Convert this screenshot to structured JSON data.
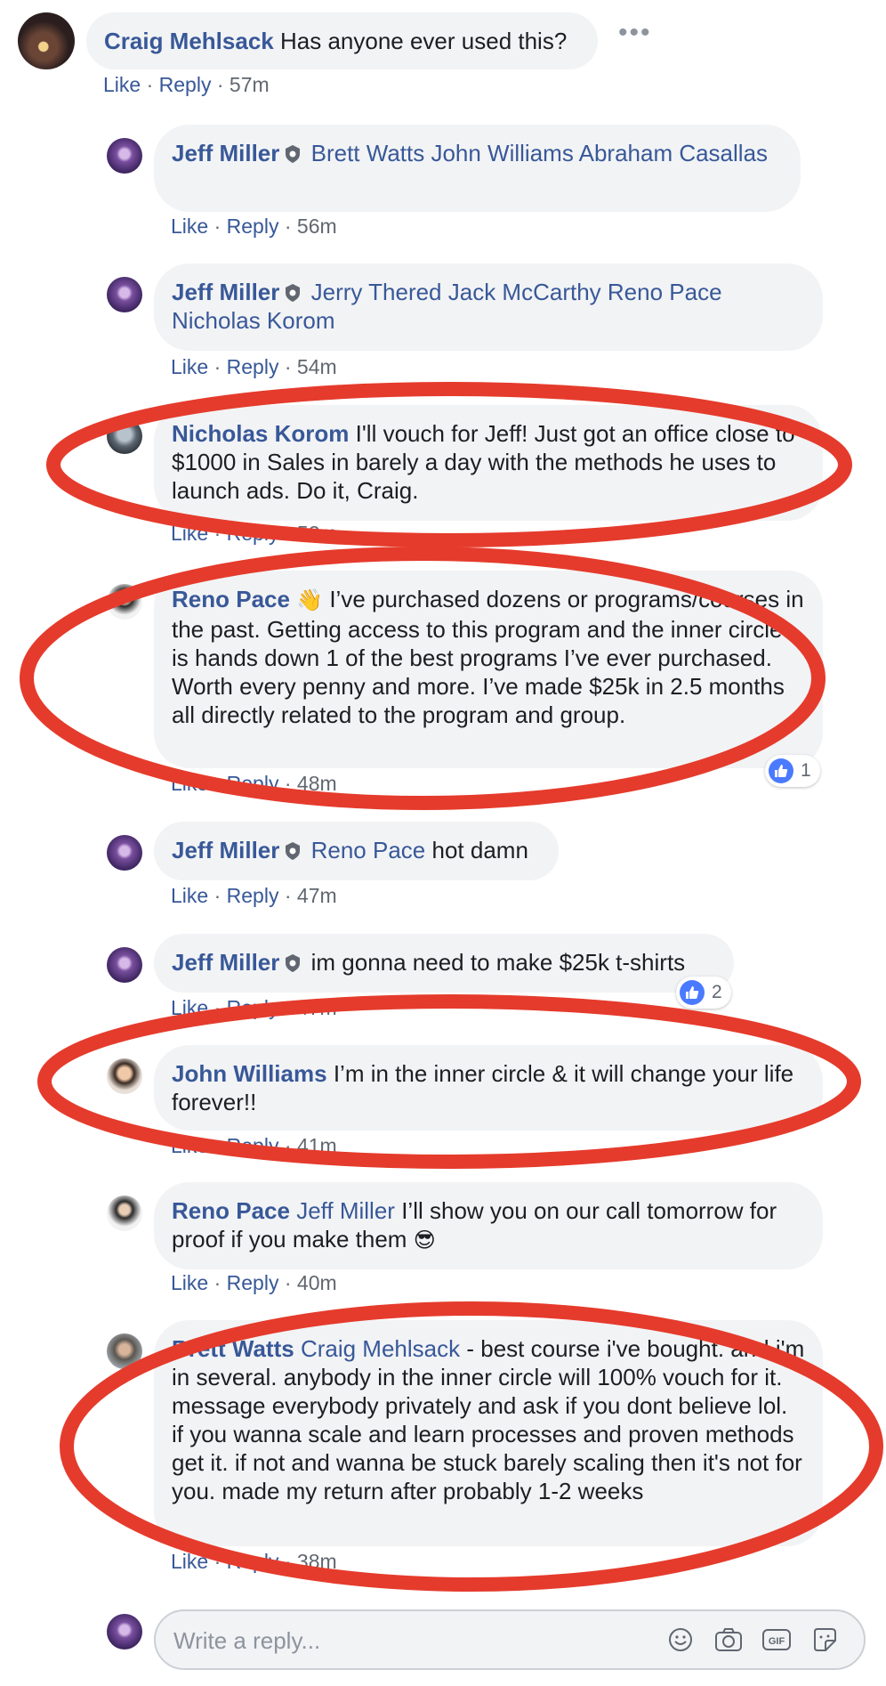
{
  "comments": {
    "top": {
      "author": "Craig Mehlsack",
      "text": "Has anyone ever used this?",
      "like": "Like",
      "reply": "Reply",
      "time": "57m"
    },
    "r1": {
      "author": "Jeff Miller",
      "tags": "Brett Watts John Williams Abraham Casallas",
      "text": "",
      "like": "Like",
      "reply": "Reply",
      "time": "56m"
    },
    "r2": {
      "author": "Jeff Miller",
      "tags": "Jerry Thered Jack McCarthy Reno Pace Nicholas Korom",
      "text": "",
      "like": "Like",
      "reply": "Reply",
      "time": "54m"
    },
    "r3": {
      "author": "Nicholas Korom",
      "text": "I'll vouch for Jeff! Just got an office close to $1000 in Sales in barely a day with the methods he uses to launch ads. Do it, Craig.",
      "like": "Like",
      "reply": "Reply",
      "time": "52m"
    },
    "r4": {
      "author": "Reno Pace",
      "emoji": "👋",
      "text": "I’ve purchased dozens or programs/courses in the past. Getting access to this program and the inner circle is hands down 1 of the best programs I’ve ever purchased. Worth every penny and more. I’ve made $25k in 2.5 months all directly related to the program and group.",
      "like": "Like",
      "reply": "Reply",
      "time": "48m",
      "reactions": "1"
    },
    "r5": {
      "author": "Jeff Miller",
      "tags": "Reno Pace",
      "text": "hot damn",
      "like": "Like",
      "reply": "Reply",
      "time": "47m"
    },
    "r6": {
      "author": "Jeff Miller",
      "text": "im gonna need to make $25k t-shirts",
      "like": "Like",
      "reply": "Reply",
      "time": "47m",
      "reactions": "2"
    },
    "r7": {
      "author": "John Williams",
      "text": "I’m in the inner circle & it will change your life forever!!",
      "like": "Like",
      "reply": "Reply",
      "time": "41m"
    },
    "r8": {
      "author": "Reno Pace",
      "tags": "Jeff Miller",
      "text": "I’ll show you on our call tomorrow for proof if you make them",
      "emoji": "😎",
      "like": "Like",
      "reply": "Reply",
      "time": "40m"
    },
    "r9": {
      "author": "Brett Watts",
      "tags": "Craig Mehlsack",
      "text": "- best course i've bought. and i'm in several. anybody in the inner circle will 100% vouch for it. message everybody privately and ask if you dont believe lol. if you wanna scale and learn processes and proven methods get it. if not and wanna be stuck barely scaling then it's not for you. made my return after probably 1-2 weeks",
      "like": "Like",
      "reply": "Reply",
      "time": "38m"
    }
  },
  "reply_box": {
    "placeholder": "Write a reply..."
  },
  "separator": "·",
  "colors": {
    "link": "#385898",
    "bubble": "#f2f3f5",
    "annotation": "#e53b2c",
    "like_blue": "#4a7aff"
  },
  "icons": [
    "more-options-icon",
    "verified-badge-icon",
    "like-reaction-icon",
    "emoji-icon",
    "camera-icon",
    "gif-icon",
    "sticker-icon"
  ]
}
